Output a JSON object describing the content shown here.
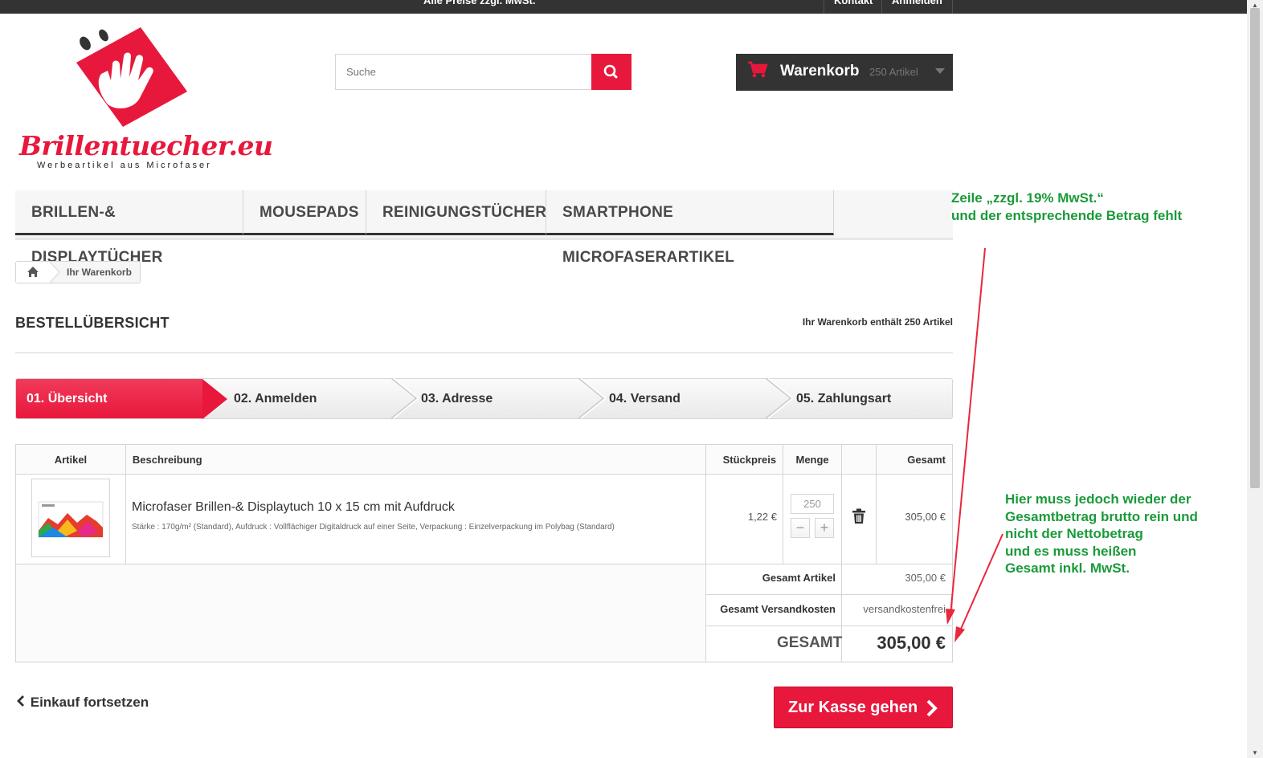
{
  "topbar": {
    "notice": "Alle Preise zzgl. MwSt.",
    "links": [
      "Kontakt",
      "Anmelden"
    ]
  },
  "logo": {
    "brand": "Brillentuecher.eu",
    "tagline": "Werbeartikel aus Microfaser"
  },
  "search": {
    "placeholder": "Suche"
  },
  "cart": {
    "title": "Warenkorb",
    "count": "250 Artikel"
  },
  "menu": {
    "items": [
      "BRILLEN-& DISPLAYTÜCHER",
      "MOUSEPADS",
      "REINIGUNGSTÜCHER",
      "SMARTPHONE MICROFASERARTIKEL"
    ]
  },
  "breadcrumb": {
    "current": "Ihr Warenkorb"
  },
  "page": {
    "title": "BESTELLÜBERSICHT",
    "cart_summary": "Ihr Warenkorb enthält 250 Artikel"
  },
  "steps": [
    "01. Übersicht",
    "02. Anmelden",
    "03. Adresse",
    "04. Versand",
    "05. Zahlungsart"
  ],
  "table": {
    "headers": {
      "artikel": "Artikel",
      "beschreibung": "Beschreibung",
      "stueckpreis": "Stückpreis",
      "menge": "Menge",
      "gesamt": "Gesamt"
    },
    "row": {
      "name": "Microfaser Brillen-& Displaytuch 10 x 15 cm mit Aufdruck",
      "attributes": "Stärke : 170g/m² (Standard), Aufdruck : Vollflächiger Digitaldruck auf einer Seite, Verpackung : Einzelverpackung im Polybag (Standard)",
      "unit_price": "1,22 €",
      "quantity": "250",
      "total": "305,00 €"
    },
    "totals": {
      "products_label": "Gesamt Artikel",
      "products_value": "305,00 €",
      "shipping_label": "Gesamt Versandkosten",
      "shipping_value": "versandkostenfrei",
      "grand_label": "GESAMT",
      "grand_value": "305,00 €"
    }
  },
  "actions": {
    "continue": "Einkauf fortsetzen",
    "checkout": "Zur Kasse gehen"
  },
  "annotations": {
    "note1": "Zeile „zzgl. 19% MwSt.“\nund der entsprechende Betrag fehlt",
    "note2": "Hier muss jedoch wieder der\nGesamtbetrag brutto rein und\nnicht der Nettobetrag\nund es muss heißen\nGesamt inkl. MwSt.",
    "note_color": "#1a9a3a",
    "arrow_color": "#e8283c"
  },
  "colors": {
    "accent": "#e8183c",
    "dark": "#333333"
  }
}
